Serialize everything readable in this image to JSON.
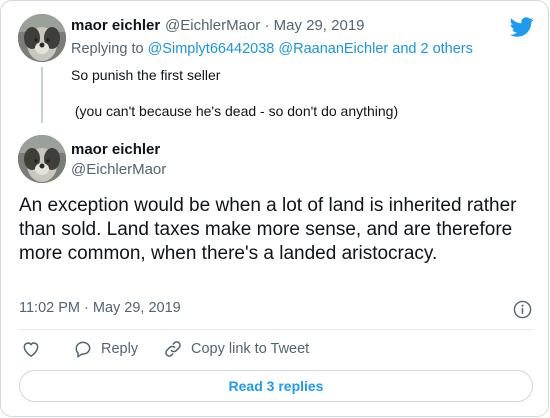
{
  "parent_tweet": {
    "author_name": "maor eichler",
    "author_handle": "@EichlerMaor",
    "separator": "·",
    "date": "May 29, 2019",
    "replying_prefix": "Replying to",
    "replying_users": "@Simplyt66442038 @RaananEichler",
    "replying_suffix": "and 2 others",
    "text": "So punish the first seller\n\n (you can't because he's dead - so don't do anything)"
  },
  "main_tweet": {
    "author_name": "maor eichler",
    "author_handle": "@EichlerMaor",
    "text": "An exception would be when a lot of land is inherited rather than sold. Land taxes make more sense, and are therefore more common, when there's a landed aristocracy.",
    "timestamp": "11:02 PM · May 29, 2019"
  },
  "actions": {
    "like_icon": "heart-icon",
    "reply_label": "Reply",
    "copy_link_label": "Copy link to Tweet"
  },
  "read_replies_label": "Read 3 replies",
  "colors": {
    "brand": "#1d9bf0",
    "text": "#0f1419",
    "muted": "#536471"
  }
}
